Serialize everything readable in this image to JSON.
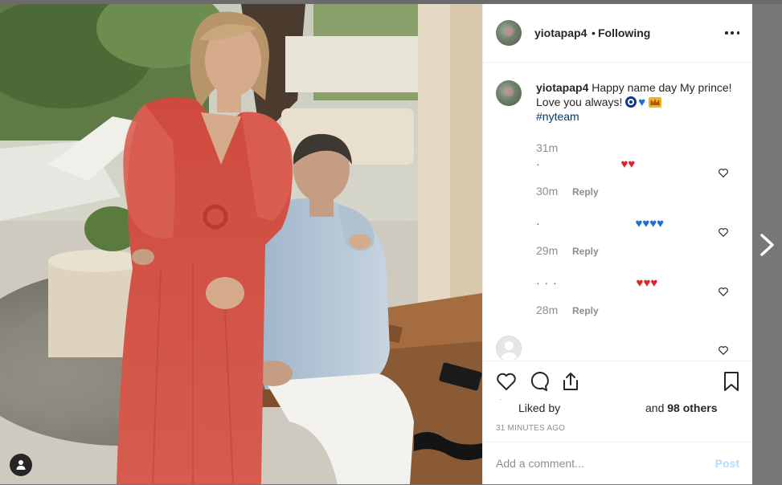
{
  "post": {
    "username": "yiotapap4",
    "separator": "•",
    "follow_status": "Following",
    "more_icon": "more-horizontal-icon"
  },
  "caption": {
    "username": "yiotapap4",
    "text": "Happy name day My prince! Love you always!",
    "hashtag": "#nyteam",
    "emojis": [
      "nazar-eye",
      "blue-heart",
      "crown"
    ],
    "time": "31m"
  },
  "comments": [
    {
      "text_hint": "·",
      "emojis": [
        "red-heart",
        "red-heart"
      ],
      "time": "30m",
      "reply": "Reply"
    },
    {
      "text_hint": "·",
      "emojis": [
        "blue-heart",
        "blue-heart",
        "blue-heart",
        "blue-heart"
      ],
      "time": "29m",
      "reply": "Reply"
    },
    {
      "text_hint": "·   ·   ·",
      "emojis": [
        "red-heart",
        "red-heart",
        "red-heart"
      ],
      "time": "28m",
      "reply": "Reply"
    }
  ],
  "likes": {
    "prefix": "Liked by",
    "suffix_and": "and",
    "count_text": "98 others"
  },
  "posted_ago": "31 MINUTES AGO",
  "add_comment": {
    "placeholder": "Add a comment...",
    "post_label": "Post"
  },
  "colors": {
    "link": "#00376b",
    "muted": "#8e8e8e",
    "post_disabled": "#b3dbff",
    "dress": "#d2483d"
  }
}
